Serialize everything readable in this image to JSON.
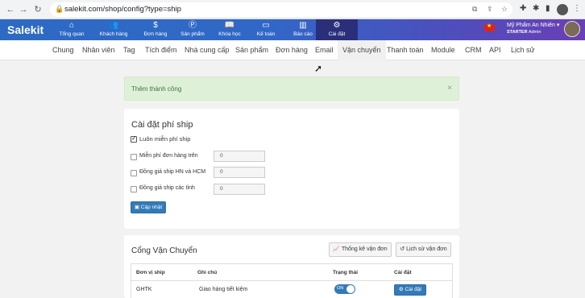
{
  "browser": {
    "url": "salekit.com/shop/config?type=ship"
  },
  "app": {
    "logo": "Salekit",
    "menu": [
      {
        "label": "Tổng quan",
        "icon": "home-icon",
        "glyph": "⌂"
      },
      {
        "label": "Khách hàng",
        "icon": "users-icon",
        "glyph": "👥"
      },
      {
        "label": "Đơn hàng",
        "icon": "dollar-icon",
        "glyph": "$"
      },
      {
        "label": "Sản phẩm",
        "icon": "product-icon",
        "glyph": "Ⓟ"
      },
      {
        "label": "Khóa học",
        "icon": "book-icon",
        "glyph": "📖"
      },
      {
        "label": "Kế toán",
        "icon": "card-icon",
        "glyph": "▭"
      },
      {
        "label": "Báo cáo",
        "icon": "chart-icon",
        "glyph": "▥"
      },
      {
        "label": "Cài đặt",
        "icon": "gear-icon",
        "glyph": "⚙"
      }
    ],
    "shop_name": "Mỹ Phẩm An Nhiên",
    "plan": "STARTER",
    "role": "Admin"
  },
  "subnav": [
    "Chung",
    "Nhân viên",
    "Tag",
    "Tích điểm",
    "Nhà cung cấp",
    "Sản phẩm",
    "Đơn hàng",
    "Email",
    "Vận chuyển",
    "Thanh toán",
    "Module",
    "CRM",
    "API",
    "Lịch sử"
  ],
  "alert": {
    "message": "Thêm thành công",
    "close": "×"
  },
  "ship_fee": {
    "title": "Cài đặt phí ship",
    "always_free": "Luôn miễn phí ship",
    "free_over": "Miễn phí đơn hàng trên",
    "free_over_value": "0",
    "flat_hn_hcm": "Đồng giá ship HN và HCM",
    "flat_hn_hcm_value": "0",
    "flat_provinces": "Đồng giá ship các tỉnh",
    "flat_provinces_value": "0",
    "update_button": "Cập nhật"
  },
  "carriers": {
    "title": "Cổng Vận Chuyển",
    "stats_button": "Thống kê vận đơn",
    "history_button": "Lịch sử vận đơn",
    "columns": [
      "Đơn vị ship",
      "Ghi chú",
      "Trạng thái",
      "Cài đặt"
    ],
    "rows": [
      {
        "name": "GHTK",
        "note": "Giao hàng tiết kiệm",
        "status": "ON",
        "action": "Cài đặt"
      }
    ]
  },
  "colors": {
    "primary": "#337ab7",
    "header_start": "#2d6ac4",
    "header_end": "#6a3fb4",
    "success_bg": "#dff0d8"
  }
}
